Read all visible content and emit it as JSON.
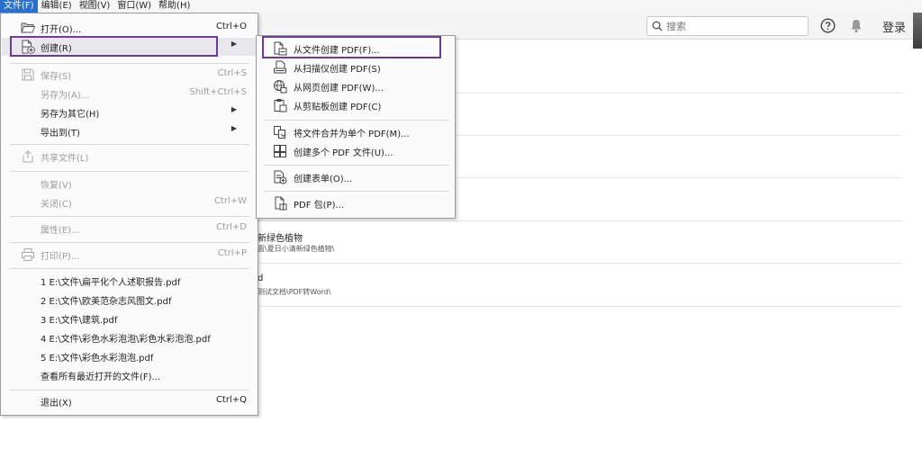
{
  "menubar": {
    "items": [
      {
        "label": "文件(F)"
      },
      {
        "label": "编辑(E)"
      },
      {
        "label": "视图(V)"
      },
      {
        "label": "窗口(W)"
      },
      {
        "label": "帮助(H)"
      }
    ]
  },
  "toolbar": {
    "search_placeholder": "搜索",
    "help_icon": "help-circle-icon",
    "bell_icon": "bell-icon",
    "login_label": "登录"
  },
  "background_list": [
    {
      "title": "新绿色植物",
      "path": "面\\夏日小清新绿色植物\\"
    },
    {
      "title": "d",
      "path": "测试文档\\PDF转Word\\"
    }
  ],
  "file_menu": {
    "open": {
      "label": "打开(O)...",
      "shortcut": "Ctrl+O"
    },
    "create": {
      "label": "创建(R)"
    },
    "save": {
      "label": "保存(S)",
      "shortcut": "Ctrl+S"
    },
    "save_as": {
      "label": "另存为(A)...",
      "shortcut": "Shift+Ctrl+S"
    },
    "save_as_other": {
      "label": "另存为其它(H)"
    },
    "export": {
      "label": "导出到(T)"
    },
    "share": {
      "label": "共享文件(L)"
    },
    "revert": {
      "label": "恢复(V)"
    },
    "close": {
      "label": "关闭(C)",
      "shortcut": "Ctrl+W"
    },
    "properties": {
      "label": "属性(E)...",
      "shortcut": "Ctrl+D"
    },
    "print": {
      "label": "打印(P)...",
      "shortcut": "Ctrl+P"
    },
    "recent": [
      {
        "label": "1 E:\\文件\\扁平化个人述职报告.pdf"
      },
      {
        "label": "2 E:\\文件\\欧美范杂志风图文.pdf"
      },
      {
        "label": "3 E:\\文件\\建筑.pdf"
      },
      {
        "label": "4 E:\\文件\\彩色水彩泡泡\\彩色水彩泡泡.pdf"
      },
      {
        "label": "5 E:\\文件\\彩色水彩泡泡.pdf"
      }
    ],
    "view_all_recent": {
      "label": "查看所有最近打开的文件(F)..."
    },
    "exit": {
      "label": "退出(X)",
      "shortcut": "Ctrl+Q"
    }
  },
  "create_submenu": [
    {
      "label": "从文件创建 PDF(F)..."
    },
    {
      "label": "从扫描仪创建 PDF(S)"
    },
    {
      "label": "从网页创建 PDF(W)..."
    },
    {
      "label": "从剪贴板创建 PDF(C)"
    },
    {
      "label": "将文件合并为单个 PDF(M)..."
    },
    {
      "label": "创建多个 PDF 文件(U)..."
    },
    {
      "label": "创建表单(O)..."
    },
    {
      "label": "PDF 包(P)..."
    }
  ],
  "colors": {
    "menu_active": "#2b6fcf",
    "highlight_box": "#6a3aa0",
    "disabled_text": "#9c9c9c"
  }
}
